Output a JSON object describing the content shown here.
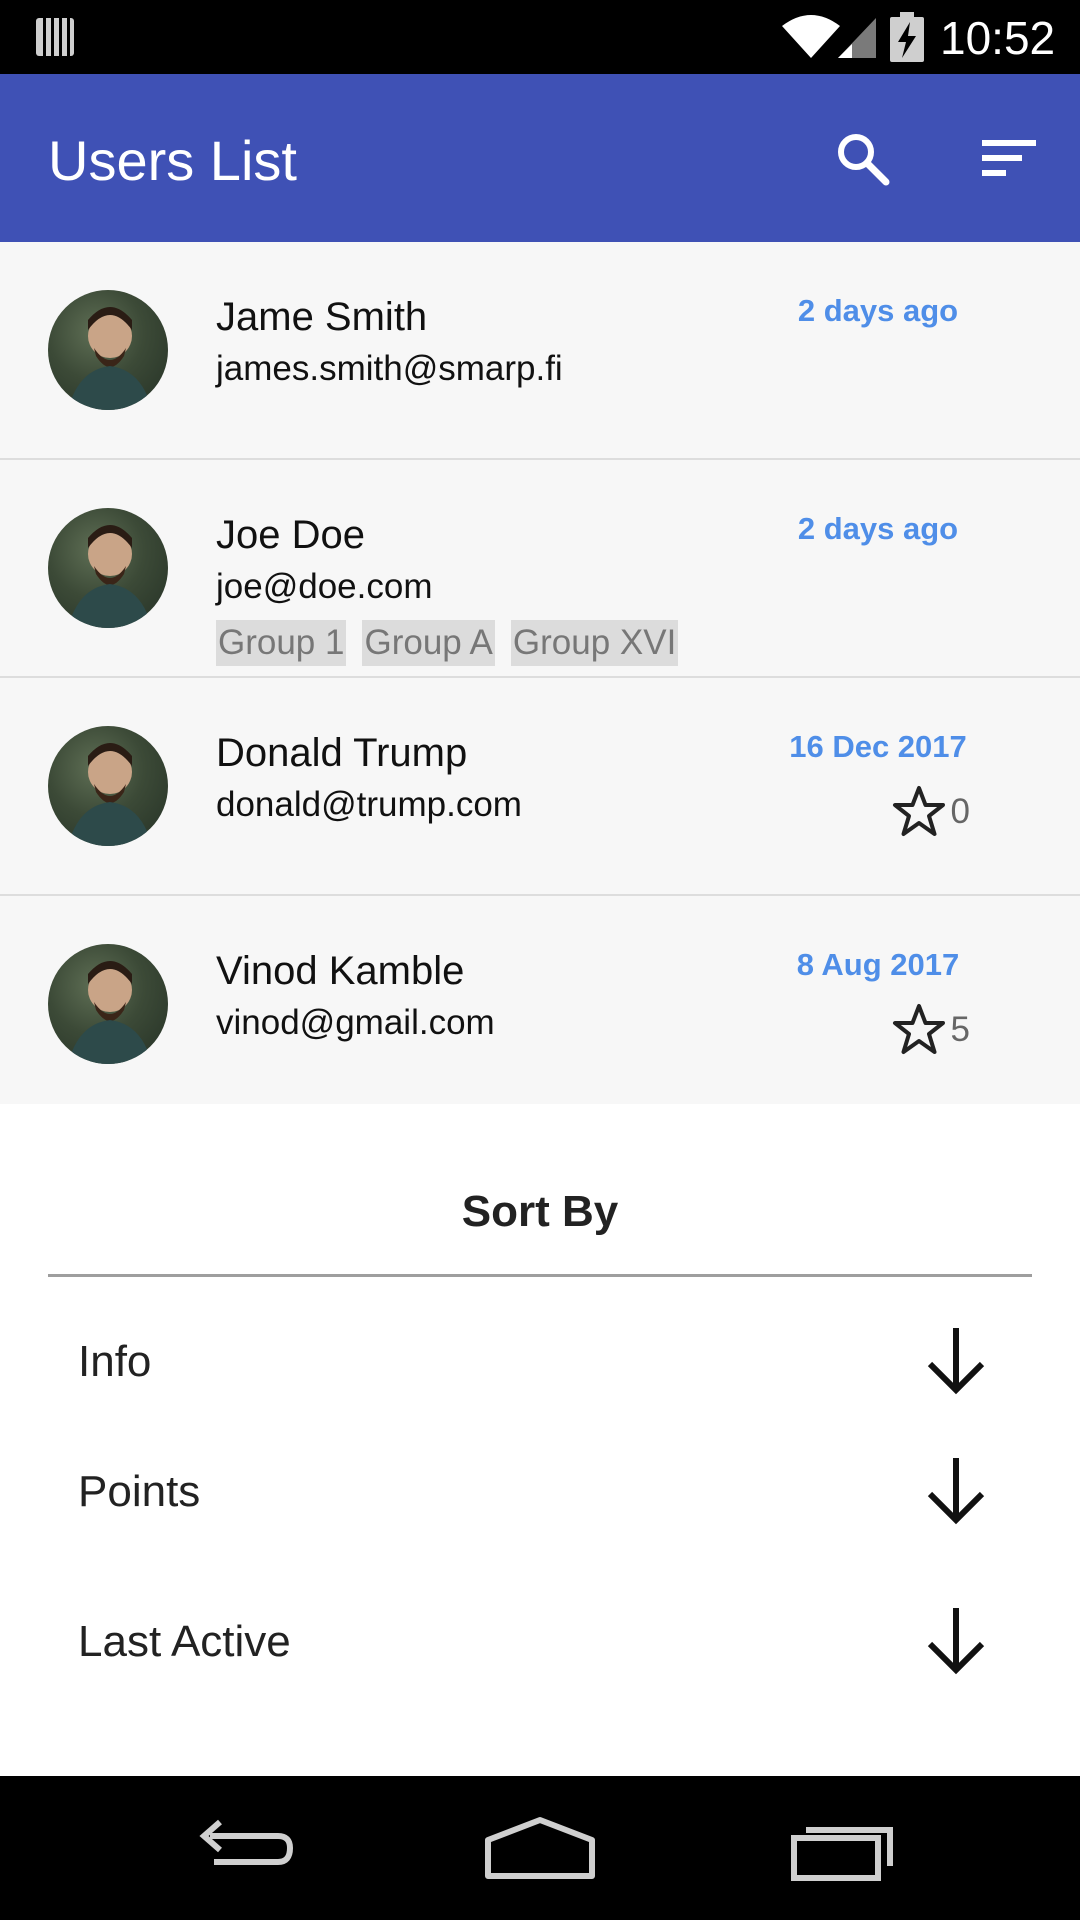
{
  "status_bar": {
    "time": "10:52",
    "icons": [
      "notification-icon",
      "wifi-icon",
      "signal-icon",
      "battery-charging-icon"
    ]
  },
  "app_bar": {
    "title": "Users List",
    "actions": [
      "search-icon",
      "sort-filter-icon"
    ]
  },
  "users": [
    {
      "name": "Jame Smith",
      "email": "james.smith@smarp.fi",
      "last_active": "2 days ago",
      "groups": [],
      "points": null
    },
    {
      "name": "Joe Doe",
      "email": "joe@doe.com",
      "last_active": "2 days ago",
      "groups": [
        "Group 1",
        "Group A",
        "Group XVI"
      ],
      "points": null
    },
    {
      "name": "Donald Trump",
      "email": "donald@trump.com",
      "last_active": "16 Dec 2017",
      "groups": [],
      "points": "0"
    },
    {
      "name": "Vinod Kamble",
      "email": "vinod@gmail.com",
      "last_active": "8 Aug 2017",
      "groups": [],
      "points": "5"
    }
  ],
  "sort_sheet": {
    "title": "Sort By",
    "options": [
      {
        "label": "Info",
        "icon": "arrow-down-icon"
      },
      {
        "label": "Points",
        "icon": "arrow-down-icon"
      },
      {
        "label": "Last Active",
        "icon": "arrow-down-icon"
      }
    ]
  },
  "nav_bar": {
    "buttons": [
      "back-icon",
      "home-icon",
      "recents-icon"
    ]
  },
  "colors": {
    "app_bar": "#3f51b5",
    "date_text": "#4f8ee8",
    "list_background": "#f7f7f7",
    "chip_background": "#dcdcdc"
  }
}
